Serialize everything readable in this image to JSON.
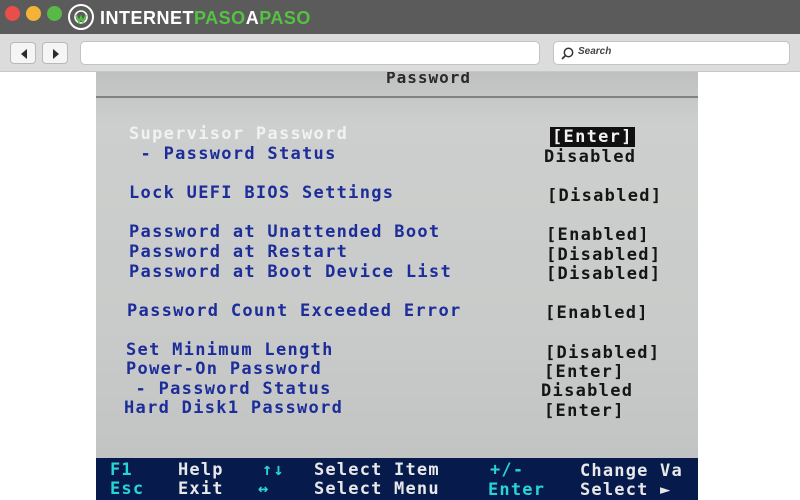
{
  "logo": {
    "text_part1": "INTERNET",
    "text_part2": "PASO",
    "text_part3": "A",
    "text_part4": "PASO",
    "colors": {
      "white": "#ffffff",
      "green": "#55c243"
    }
  },
  "toolbar": {
    "search_placeholder": "Search"
  },
  "bios": {
    "title": "Password",
    "items": [
      {
        "label": "Supervisor Password",
        "value": "[Enter]"
      },
      {
        "label": " - Password Status",
        "value": "Disabled"
      },
      {
        "label": "Lock UEFI BIOS Settings",
        "value": "[Disabled]"
      },
      {
        "label": "Password at Unattended Boot",
        "value": "[Enabled]"
      },
      {
        "label": "Password at Restart",
        "value": "[Disabled]"
      },
      {
        "label": "Password at Boot Device List",
        "value": "[Disabled]"
      },
      {
        "label": "Password Count Exceeded Error",
        "value": "[Enabled]"
      },
      {
        "label": "Set Minimum Length",
        "value": "[Disabled]"
      },
      {
        "label": "Power-On Password",
        "value": "[Enter]"
      },
      {
        "label": " - Password Status",
        "value": "Disabled"
      },
      {
        "label": "Hard Disk1 Password",
        "value": "[Enter]"
      }
    ],
    "footer": {
      "row1": [
        {
          "key": "F1",
          "desc": "Help"
        },
        {
          "key": "↑↓",
          "desc": "Select Item"
        },
        {
          "key": "+/-",
          "desc": "Change Va"
        }
      ],
      "row2": [
        {
          "key": "Esc",
          "desc": "Exit"
        },
        {
          "key": "↔",
          "desc": "Select Menu"
        },
        {
          "key": "Enter",
          "desc": "Select ►"
        }
      ]
    },
    "colors": {
      "option_text": "#1c2d9a",
      "highlighted_text": "#f1f1f1",
      "footer_bg": "#061a4c",
      "footer_key": "#2ad4d6"
    }
  }
}
